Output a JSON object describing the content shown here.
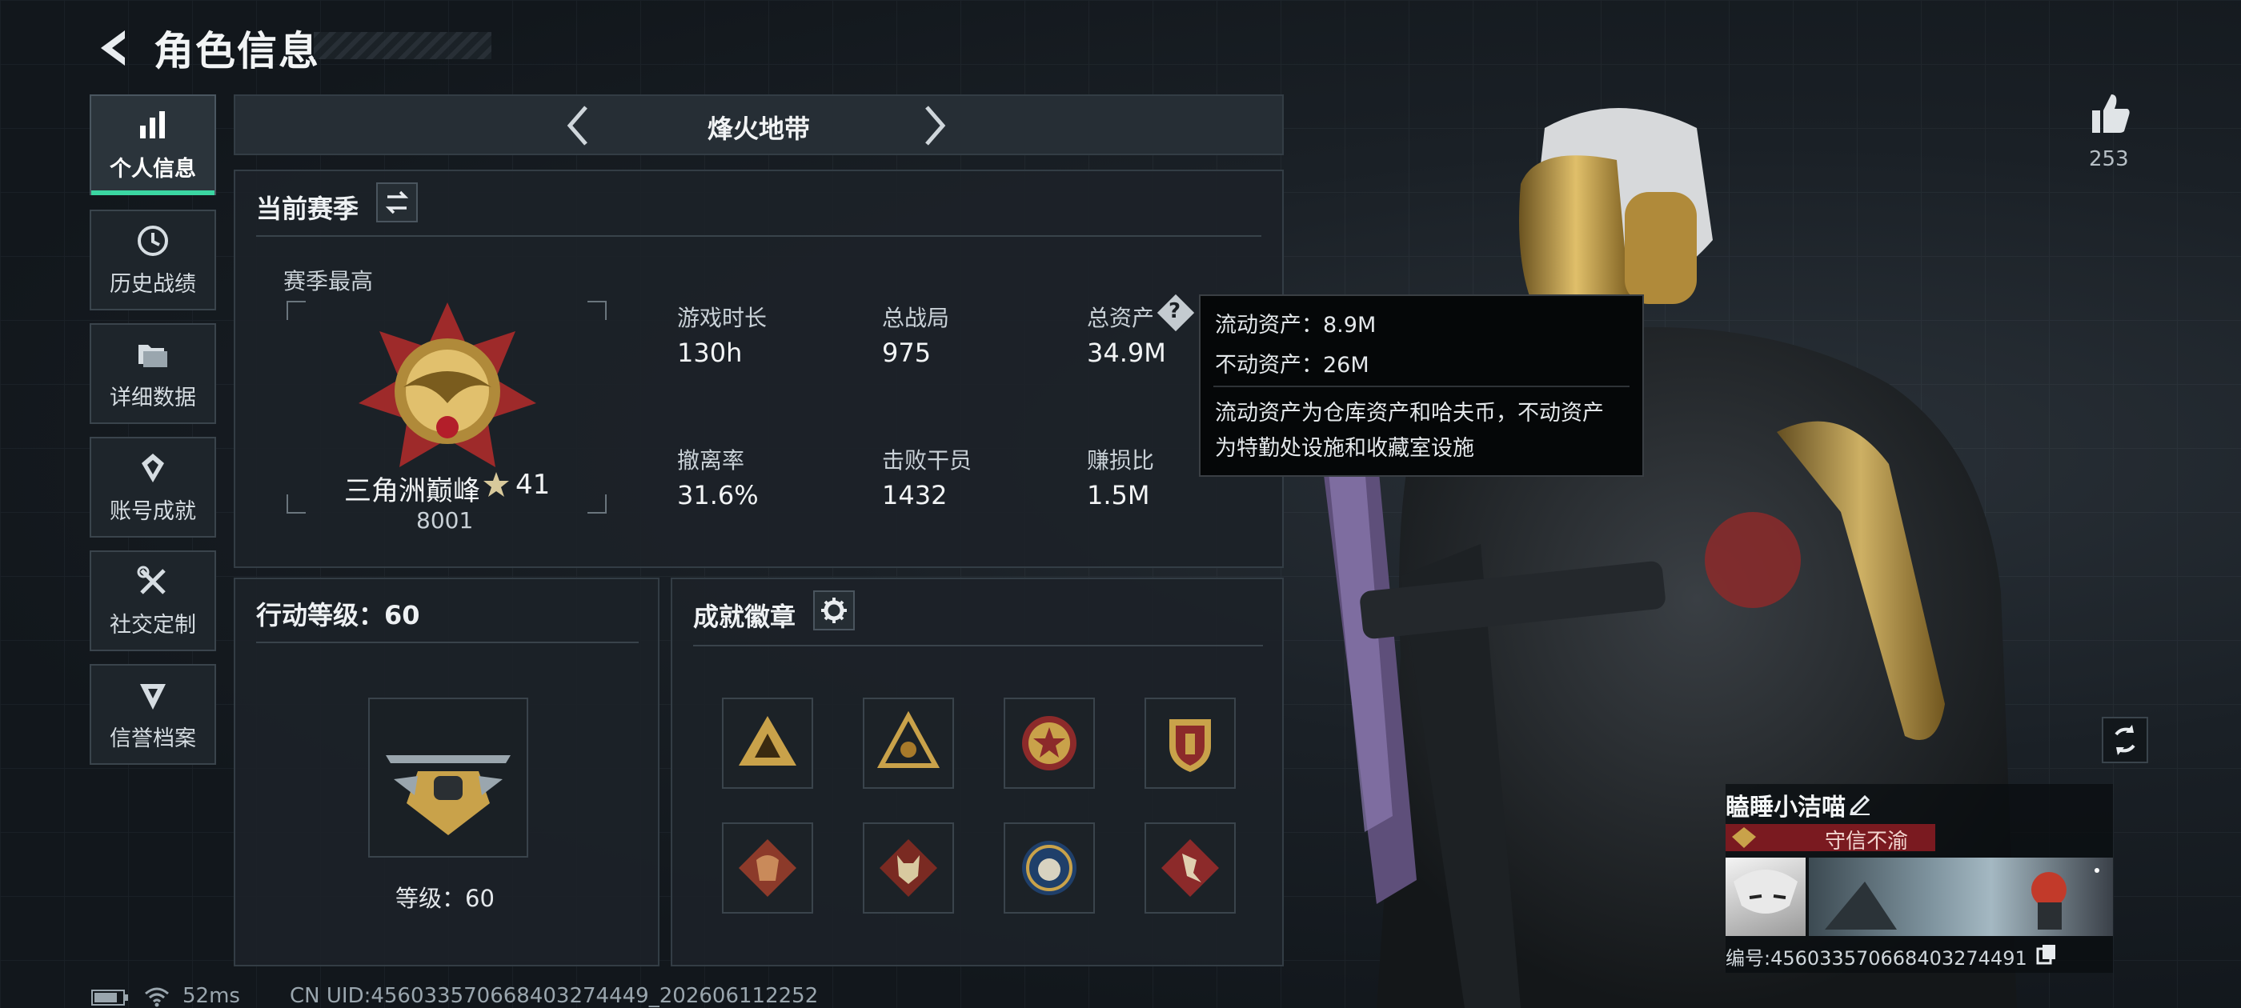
{
  "header": {
    "title": "角色信息"
  },
  "nav": [
    {
      "label": "个人信息",
      "icon": "bar-chart-icon",
      "active": true
    },
    {
      "label": "历史战绩",
      "icon": "clock-history-icon",
      "active": false
    },
    {
      "label": "详细数据",
      "icon": "folder-icon",
      "active": false
    },
    {
      "label": "账号成就",
      "icon": "achievement-icon",
      "active": false
    },
    {
      "label": "社交定制",
      "icon": "wrench-tools-icon",
      "active": false
    },
    {
      "label": "信誉档案",
      "icon": "credit-shield-icon",
      "active": false
    }
  ],
  "mode": {
    "title": "烽火地带"
  },
  "season": {
    "title": "当前赛季",
    "best_label": "赛季最高",
    "rank_name": "三角洲巅峰",
    "rank_stars": "41",
    "rank_points": "8001",
    "stats": [
      {
        "label": "游戏时长",
        "value": "130h"
      },
      {
        "label": "总战局",
        "value": "975"
      },
      {
        "label": "总资产",
        "value": "34.9M"
      },
      {
        "label": "撤离率",
        "value": "31.6%"
      },
      {
        "label": "击败干员",
        "value": "1432"
      },
      {
        "label": "赚损比",
        "value": "1.5M"
      }
    ]
  },
  "tooltip": {
    "line1": "流动资产：8.9M",
    "line2": "不动资产：26M",
    "line3": "流动资产为仓库资产和哈夫币，不动资产",
    "line4": "为特勤处设施和收藏室设施"
  },
  "action_level": {
    "title": "行动等级：60",
    "level_label": "等级：60"
  },
  "badges": {
    "title": "成就徽章",
    "items": [
      "badge-delta-icon",
      "badge-triangle-icon",
      "badge-star-icon",
      "badge-shield-icon",
      "badge-dragon-icon",
      "badge-wolf-icon",
      "badge-bear-icon",
      "badge-runner-icon"
    ]
  },
  "likes": {
    "count": "253"
  },
  "player": {
    "name": "瞌睡小洁喵",
    "title": "守信不渝",
    "id_text": "编号:456033570668403274491"
  },
  "status_bar": {
    "ping": "52ms",
    "uid": "CN UID:456033570668403274449_202606112252"
  },
  "colors": {
    "accent": "#3bd6a2",
    "gold": "#c9a24a",
    "title_red": "#8a1c22"
  }
}
